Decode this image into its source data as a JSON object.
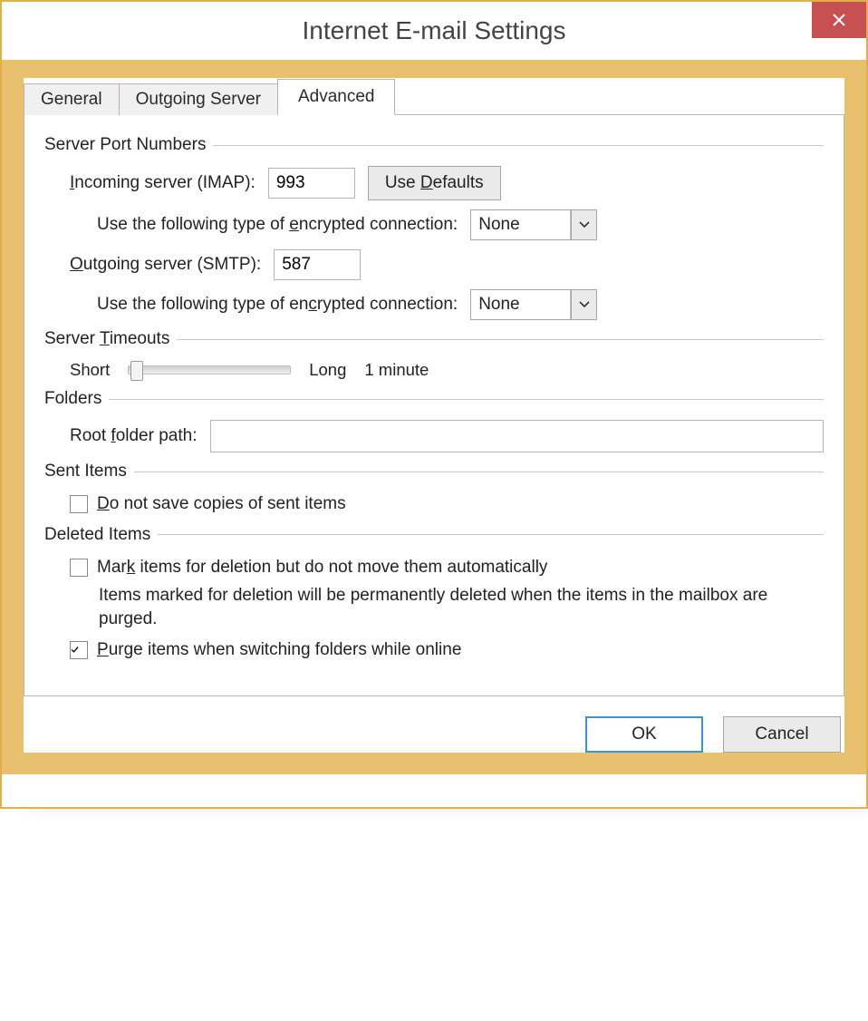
{
  "dialog": {
    "title": "Internet E-mail Settings"
  },
  "tabs": {
    "general": "General",
    "outgoing": "Outgoing Server",
    "advanced": "Advanced",
    "active": "advanced"
  },
  "server_ports": {
    "heading": "Server Port Numbers",
    "incoming_label_pre": "I",
    "incoming_label_post": "ncoming server (IMAP):",
    "incoming_value": "993",
    "defaults_button_pre": "Use ",
    "defaults_button_u": "D",
    "defaults_button_post": "efaults",
    "encryption_label_pre": "Use the following type of ",
    "encryption_label_u": "e",
    "encryption_label_post": "ncrypted connection:",
    "incoming_encryption_value": "None",
    "outgoing_label_u": "O",
    "outgoing_label_post": "utgoing server (SMTP):",
    "outgoing_value": "587",
    "outgoing_encryption_label_pre": "Use the following type of en",
    "outgoing_encryption_label_u": "c",
    "outgoing_encryption_label_post": "rypted connection:",
    "outgoing_encryption_value": "None"
  },
  "timeouts": {
    "heading_pre": "Server ",
    "heading_u": "T",
    "heading_post": "imeouts",
    "short_label": "Short",
    "long_label": "Long",
    "value_label": "1 minute"
  },
  "folders": {
    "heading": "Folders",
    "root_label_pre": "Root ",
    "root_label_u": "f",
    "root_label_post": "older path:",
    "root_value": ""
  },
  "sent_items": {
    "heading": "Sent Items",
    "checkbox_u": "D",
    "checkbox_post": "o not save copies of sent items",
    "checked": false
  },
  "deleted_items": {
    "heading": "Deleted Items",
    "mark_pre": "Mar",
    "mark_u": "k",
    "mark_post": " items for deletion but do not move them automatically",
    "mark_checked": false,
    "hint": "Items marked for deletion will be permanently deleted when the items in the mailbox are purged.",
    "purge_u": "P",
    "purge_post": "urge items when switching folders while online",
    "purge_checked": true
  },
  "buttons": {
    "ok": "OK",
    "cancel": "Cancel"
  }
}
